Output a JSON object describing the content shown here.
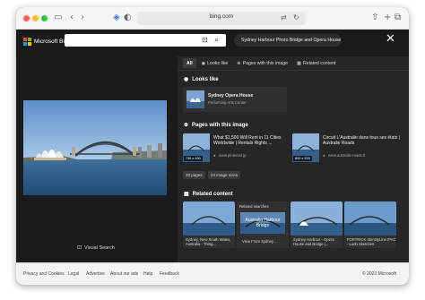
{
  "browser": {
    "url": "bing.com",
    "colors": {
      "close": "#ff5f57",
      "minimize": "#febc2e",
      "zoom": "#28c840"
    }
  },
  "header": {
    "logo_text": "Microsoft Bing",
    "query_pill": "Sydney Harbour Photo Bridge and Opera House"
  },
  "viewer": {
    "visual_search_label": "Visual Search"
  },
  "tabs": [
    {
      "label": "All",
      "active": true
    },
    {
      "label": "Looks like",
      "icon": "eye-icon"
    },
    {
      "label": "Pages with this image",
      "icon": "globe-icon"
    },
    {
      "label": "Related content",
      "icon": "grid-icon"
    }
  ],
  "looks_like": {
    "title": "Looks like",
    "item": {
      "name": "Sydney Opera House",
      "subtitle": "Performing Arts Center"
    }
  },
  "pages": {
    "title": "Pages with this image",
    "items": [
      {
        "title": "What $1,500 Will Rent in 11 Cities Worldwide | Rentals Rights ...",
        "site": "www.pinterest.jp",
        "dim": "736 x 490"
      },
      {
        "title": "Circuit L'Australie dans tous ses états | Australie Roads",
        "site": "www.australie-roads.fr",
        "dim": "800 x 533"
      }
    ],
    "chips": [
      "33 pages",
      "24 image sizes"
    ]
  },
  "related": {
    "title": "Related content",
    "cards": [
      {
        "label": "Sydney, New South Wales, Australia - Thing..."
      },
      {
        "label": "Related searches",
        "overlay": "Australia Harbour Bridge",
        "footer": "View From Sydney ..."
      },
      {
        "label": "Sydney Harbour - Opera House and Bridge |..."
      },
      {
        "label": "FORTRICK IdentityLine IPAC - Ludo Sketches"
      }
    ]
  },
  "footer": {
    "links": [
      "Privacy and Cookies",
      "Legal",
      "Advertise",
      "About our ads",
      "Help",
      "Feedback"
    ],
    "copyright": "© 2023 Microsoft"
  }
}
